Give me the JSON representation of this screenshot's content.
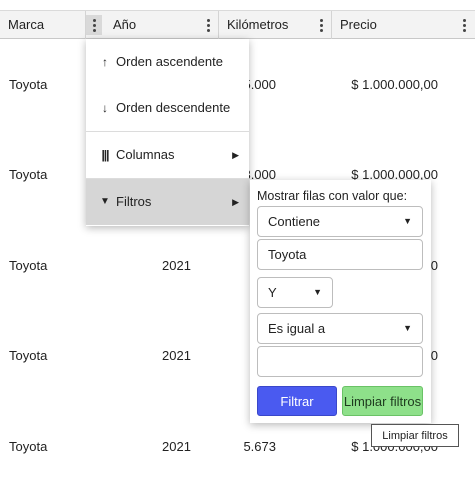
{
  "header": {
    "columns": [
      {
        "label": "Marca"
      },
      {
        "label": "Año"
      },
      {
        "label": "Kilómetros"
      },
      {
        "label": "Precio"
      }
    ]
  },
  "rows": [
    {
      "marca": "Toyota",
      "anio": "",
      "km": "35.000",
      "precio": "$ 1.000.000,00"
    },
    {
      "marca": "Toyota",
      "anio": "",
      "km": "53.000",
      "precio": "$ 1.000.000,00"
    },
    {
      "marca": "Toyota",
      "anio": "2021",
      "km": "",
      "precio": "0"
    },
    {
      "marca": "Toyota",
      "anio": "2021",
      "km": "",
      "precio": "0"
    },
    {
      "marca": "Toyota",
      "anio": "2021",
      "km": "5.673",
      "precio": "$ 1.000.000,00"
    }
  ],
  "column_menu": {
    "items": [
      {
        "icon": "arrow-up-icon",
        "glyph": "↑",
        "label": "Orden ascendente"
      },
      {
        "icon": "arrow-down-icon",
        "glyph": "↓",
        "label": "Orden descendente"
      },
      {
        "icon": "columns-icon",
        "glyph": "|||",
        "label": "Columnas"
      },
      {
        "icon": "filter-icon",
        "glyph": "▼",
        "label": "Filtros"
      }
    ]
  },
  "filter_panel": {
    "title": "Mostrar filas con valor que:",
    "condition1": "Contiene",
    "value1": "Toyota",
    "operator": "Y",
    "condition2": "Es igual a",
    "value2": "",
    "filter_button": "Filtrar",
    "clear_button": "Limpiar filtros"
  },
  "tooltip": "Limpiar filtros",
  "colors": {
    "header_bg": "#f3f3f3",
    "filter_button": "#4a5af0",
    "clear_button": "#8ee08a",
    "active_item": "#d6d6d6"
  }
}
